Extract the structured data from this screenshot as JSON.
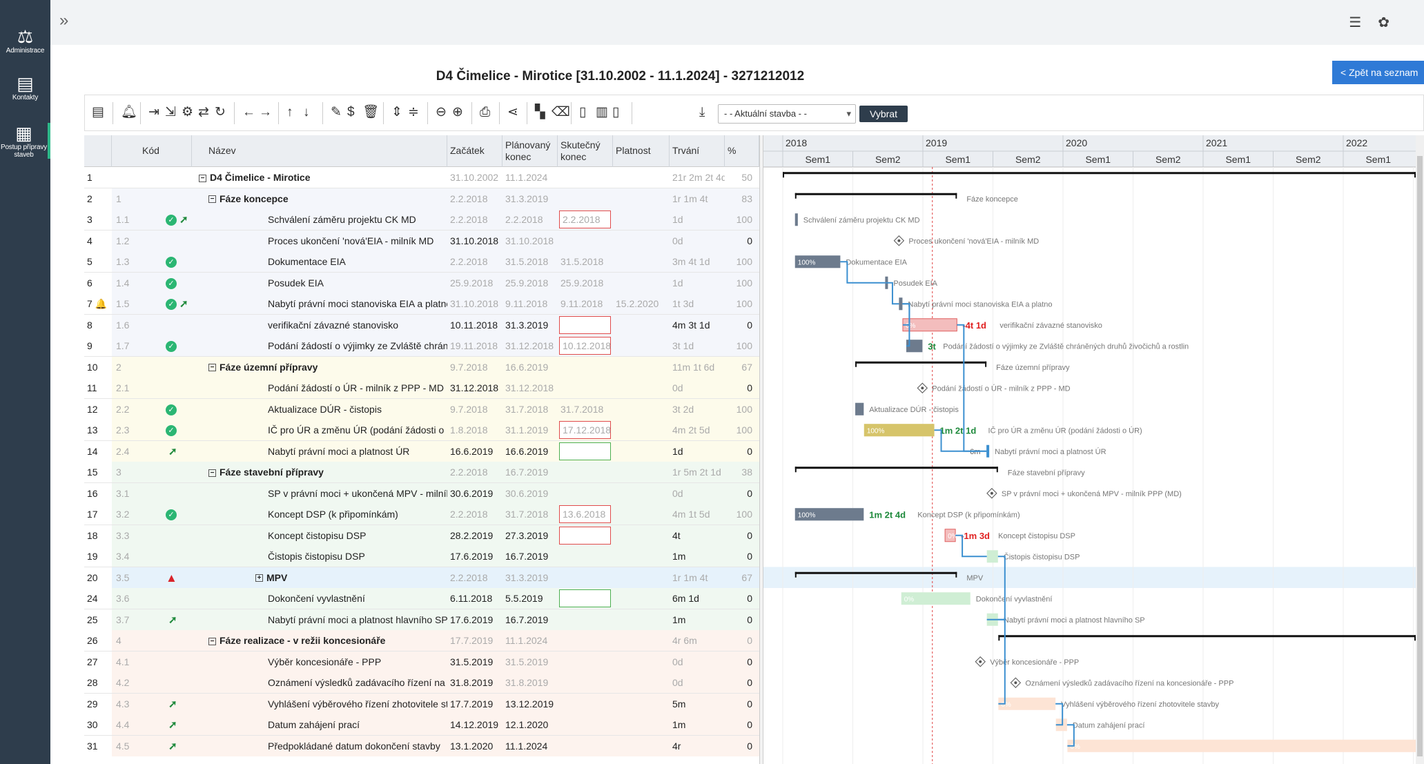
{
  "sidebar": [
    {
      "label": "Administrace",
      "icon": "scales-icon"
    },
    {
      "label": "Kontakty",
      "icon": "address-card-icon"
    },
    {
      "label": "Postup přípravy staveb",
      "icon": "building-icon"
    }
  ],
  "topbar": {
    "collapse_icon": "double-chevron-right-icon",
    "settings_icon": "sliders-icon",
    "user_icon": "paw-icon"
  },
  "page": {
    "title": "D4 Čimelice - Mirotice [31.10.2002 - 11.1.2024] - 3271212012",
    "back_label": "< Zpět na seznam"
  },
  "toolbar": {
    "select_value": "- - Aktuální stavba - -",
    "select_button": "Vybrat"
  },
  "columns": [
    "Kód",
    "Název",
    "Začátek",
    "Plánovaný konec",
    "Skutečný konec",
    "Platnost",
    "Trvání",
    "%"
  ],
  "rows": [
    {
      "n": "1",
      "code": "",
      "name": "D4 Čimelice - Mirotice",
      "start": "31.10.2002",
      "plan": "11.1.2024",
      "actual": "",
      "valid": "",
      "dur": "21r 2m 2t 4d",
      "pct": "50",
      "level": 0,
      "bold": true,
      "toggle": "−",
      "grey": true,
      "bg": "#ffffff"
    },
    {
      "n": "2",
      "code": "1",
      "name": "Fáze koncepce",
      "start": "2.2.2018",
      "plan": "31.3.2019",
      "actual": "",
      "valid": "",
      "dur": "1r 1m 4t",
      "pct": "83",
      "level": 1,
      "bold": true,
      "toggle": "−",
      "grey": true,
      "bg": "#f4f6fb"
    },
    {
      "n": "3",
      "code": "1.1",
      "name": "Schválení záměru projektu CK MD",
      "start": "2.2.2018",
      "plan": "2.2.2018",
      "actual": "2.2.2018",
      "valid": "",
      "dur": "1d",
      "pct": "100",
      "level": 2,
      "icons": [
        "check",
        "arrow"
      ],
      "box": "red",
      "grey": true,
      "bg": "#f4f6fb"
    },
    {
      "n": "4",
      "code": "1.2",
      "name": "Proces ukončení 'nová'EIA - milník MD",
      "start": "31.10.2018",
      "plan": "31.10.2018",
      "actual": "",
      "valid": "",
      "dur": "0d",
      "pct": "0",
      "level": 2,
      "grey": false,
      "planGrey": true,
      "durGrey": true,
      "bg": "#f4f6fb"
    },
    {
      "n": "5",
      "code": "1.3",
      "name": "Dokumentace EIA",
      "start": "2.2.2018",
      "plan": "31.5.2018",
      "actual": "31.5.2018",
      "valid": "",
      "dur": "3m 4t 1d",
      "pct": "100",
      "level": 2,
      "icons": [
        "check"
      ],
      "grey": true,
      "bg": "#f4f6fb"
    },
    {
      "n": "6",
      "code": "1.4",
      "name": "Posudek EIA",
      "start": "25.9.2018",
      "plan": "25.9.2018",
      "actual": "25.9.2018",
      "valid": "",
      "dur": "1d",
      "pct": "100",
      "level": 2,
      "icons": [
        "check"
      ],
      "grey": true,
      "bg": "#f4f6fb"
    },
    {
      "n": "7 🔔",
      "code": "1.5",
      "name": "Nabytí právní moci stanoviska EIA a platnost",
      "start": "31.10.2018",
      "plan": "9.11.2018",
      "actual": "9.11.2018",
      "valid": "15.2.2020",
      "dur": "1t 3d",
      "pct": "100",
      "level": 2,
      "icons": [
        "check",
        "arrow"
      ],
      "grey": true,
      "bg": "#f4f6fb"
    },
    {
      "n": "8",
      "code": "1.6",
      "name": "verifikační závazné stanovisko",
      "start": "10.11.2018",
      "plan": "31.3.2019",
      "actual": "",
      "valid": "",
      "dur": "4m 3t 1d",
      "pct": "0",
      "level": 2,
      "box": "red",
      "grey": false,
      "bg": "#f4f6fb"
    },
    {
      "n": "9",
      "code": "1.7",
      "name": "Podání žádostí o výjimky ze Zvláště chráněných d",
      "start": "19.11.2018",
      "plan": "31.12.2018",
      "actual": "10.12.2018",
      "valid": "",
      "dur": "3t 1d",
      "pct": "100",
      "level": 2,
      "icons": [
        "check"
      ],
      "box": "red",
      "grey": true,
      "bg": "#f4f6fb"
    },
    {
      "n": "10",
      "code": "2",
      "name": "Fáze územní přípravy",
      "start": "9.7.2018",
      "plan": "16.6.2019",
      "actual": "",
      "valid": "",
      "dur": "11m 1t 6d",
      "pct": "67",
      "level": 1,
      "bold": true,
      "toggle": "−",
      "grey": true,
      "bg": "#fdfbeb"
    },
    {
      "n": "11",
      "code": "2.1",
      "name": "Podání žádostí o ÚR - milník z PPP - MD",
      "start": "31.12.2018",
      "plan": "31.12.2018",
      "actual": "",
      "valid": "",
      "dur": "0d",
      "pct": "0",
      "level": 2,
      "grey": false,
      "planGrey": true,
      "durGrey": true,
      "bg": "#fdfbeb"
    },
    {
      "n": "12",
      "code": "2.2",
      "name": "Aktualizace DÚR - čistopis",
      "start": "9.7.2018",
      "plan": "31.7.2018",
      "actual": "31.7.2018",
      "valid": "",
      "dur": "3t 2d",
      "pct": "100",
      "level": 2,
      "icons": [
        "check"
      ],
      "grey": true,
      "bg": "#fdfbeb"
    },
    {
      "n": "13",
      "code": "2.3",
      "name": "IČ pro ÚR a změnu ÚR (podání žádosti o ÚR)",
      "start": "1.8.2018",
      "plan": "31.1.2019",
      "actual": "17.12.2018",
      "valid": "",
      "dur": "4m 2t 5d",
      "pct": "100",
      "level": 2,
      "icons": [
        "check"
      ],
      "box": "red",
      "grey": true,
      "bg": "#fdfbeb"
    },
    {
      "n": "14",
      "code": "2.4",
      "name": "Nabytí právní moci a platnost ÚR",
      "start": "16.6.2019",
      "plan": "16.6.2019",
      "actual": "",
      "valid": "",
      "dur": "1d",
      "pct": "0",
      "level": 2,
      "icons": [
        "arrow"
      ],
      "box": "green",
      "grey": false,
      "bg": "#fdfbeb"
    },
    {
      "n": "15",
      "code": "3",
      "name": "Fáze stavební přípravy",
      "start": "2.2.2018",
      "plan": "16.7.2019",
      "actual": "",
      "valid": "",
      "dur": "1r 5m 2t 1d",
      "pct": "38",
      "level": 1,
      "bold": true,
      "toggle": "−",
      "grey": true,
      "bg": "#f0f8f1"
    },
    {
      "n": "16",
      "code": "3.1",
      "name": "SP v právní moci + ukončená MPV - milník PPP (",
      "start": "30.6.2019",
      "plan": "30.6.2019",
      "actual": "",
      "valid": "",
      "dur": "0d",
      "pct": "0",
      "level": 2,
      "grey": false,
      "planGrey": true,
      "durGrey": true,
      "bg": "#f0f8f1"
    },
    {
      "n": "17",
      "code": "3.2",
      "name": "Koncept DSP (k připomínkám)",
      "start": "2.2.2018",
      "plan": "31.7.2018",
      "actual": "13.6.2018",
      "valid": "",
      "dur": "4m 1t 5d",
      "pct": "100",
      "level": 2,
      "icons": [
        "check"
      ],
      "box": "red",
      "grey": true,
      "bg": "#f0f8f1"
    },
    {
      "n": "18",
      "code": "3.3",
      "name": "Koncept čistopisu DSP",
      "start": "28.2.2019",
      "plan": "27.3.2019",
      "actual": "",
      "valid": "",
      "dur": "4t",
      "pct": "0",
      "level": 2,
      "box": "red",
      "grey": false,
      "bg": "#f0f8f1"
    },
    {
      "n": "19",
      "code": "3.4",
      "name": "Čistopis čistopisu DSP",
      "start": "17.6.2019",
      "plan": "16.7.2019",
      "actual": "",
      "valid": "",
      "dur": "1m",
      "pct": "0",
      "level": 2,
      "grey": false,
      "bg": "#f0f8f1"
    },
    {
      "n": "20",
      "code": "3.5",
      "name": "MPV",
      "start": "2.2.2018",
      "plan": "31.3.2019",
      "actual": "",
      "valid": "",
      "dur": "1r 1m 4t",
      "pct": "67",
      "level": 1.5,
      "bold": true,
      "toggle": "+",
      "icons": [
        "warn"
      ],
      "grey": true,
      "bg": "#e6f2fb"
    },
    {
      "n": "24",
      "code": "3.6",
      "name": "Dokončení vyvlastnění",
      "start": "6.11.2018",
      "plan": "5.5.2019",
      "actual": "",
      "valid": "",
      "dur": "6m 1d",
      "pct": "0",
      "level": 2,
      "box": "green",
      "grey": false,
      "bg": "#f0f8f1"
    },
    {
      "n": "25",
      "code": "3.7",
      "name": "Nabytí právní moci a platnost hlavního SP",
      "start": "17.6.2019",
      "plan": "16.7.2019",
      "actual": "",
      "valid": "",
      "dur": "1m",
      "pct": "0",
      "level": 2,
      "icons": [
        "arrow"
      ],
      "grey": false,
      "bg": "#f0f8f1"
    },
    {
      "n": "26",
      "code": "4",
      "name": "Fáze realizace - v režii koncesionáře",
      "start": "17.7.2019",
      "plan": "11.1.2024",
      "actual": "",
      "valid": "",
      "dur": "4r 6m",
      "pct": "0",
      "level": 1,
      "bold": true,
      "toggle": "−",
      "grey": true,
      "bg": "#fdf3ee"
    },
    {
      "n": "27",
      "code": "4.1",
      "name": "Výběr koncesionáře - PPP",
      "start": "31.5.2019",
      "plan": "31.5.2019",
      "actual": "",
      "valid": "",
      "dur": "0d",
      "pct": "0",
      "level": 2,
      "grey": false,
      "planGrey": true,
      "durGrey": true,
      "bg": "#fdf3ee"
    },
    {
      "n": "28",
      "code": "4.2",
      "name": "Oznámení výsledků zadávacího řízení na koncesi",
      "start": "31.8.2019",
      "plan": "31.8.2019",
      "actual": "",
      "valid": "",
      "dur": "0d",
      "pct": "0",
      "level": 2,
      "grey": false,
      "planGrey": true,
      "durGrey": true,
      "bg": "#fdf3ee"
    },
    {
      "n": "29",
      "code": "4.3",
      "name": "Vyhlášení výběrového řízení zhotovitele stavby",
      "start": "17.7.2019",
      "plan": "13.12.2019",
      "actual": "",
      "valid": "",
      "dur": "5m",
      "pct": "0",
      "level": 2,
      "icons": [
        "arrow"
      ],
      "grey": false,
      "bg": "#fdf3ee"
    },
    {
      "n": "30",
      "code": "4.4",
      "name": "Datum zahájení prací",
      "start": "14.12.2019",
      "plan": "12.1.2020",
      "actual": "",
      "valid": "",
      "dur": "1m",
      "pct": "0",
      "level": 2,
      "icons": [
        "arrow"
      ],
      "grey": false,
      "bg": "#fdf3ee"
    },
    {
      "n": "31",
      "code": "4.5",
      "name": "Předpokládané datum dokončení stavby",
      "start": "13.1.2020",
      "plan": "11.1.2024",
      "actual": "",
      "valid": "",
      "dur": "4r",
      "pct": "0",
      "level": 2,
      "icons": [
        "arrow"
      ],
      "grey": false,
      "bg": "#fdf3ee"
    }
  ],
  "gantt": {
    "years": [
      "2018",
      "2019",
      "2020",
      "2021",
      "2022"
    ],
    "semesters": [
      "Sem1",
      "Sem2",
      "Sem1",
      "Sem2",
      "Sem1",
      "Sem2",
      "Sem1",
      "Sem2",
      "Sem1"
    ],
    "colors": {
      "done": "#6d7b8d",
      "doneLight": "#c7ced9",
      "late": "#e06060",
      "lateLight": "#f3bdbd",
      "yellow": "#d6c46a",
      "green": "#8fcf98",
      "orange": "#f8c6aa",
      "link": "#3b8fd0",
      "today": "#e04040"
    },
    "items": [
      {
        "row": 1,
        "kind": "summary",
        "start": "2018-01-01",
        "end": "2022-12-31",
        "label": ""
      },
      {
        "row": 2,
        "kind": "summary",
        "start": "2018-02-02",
        "end": "2019-03-31",
        "label": "Fáze koncepce"
      },
      {
        "row": 3,
        "kind": "bar",
        "start": "2018-02-02",
        "end": "2018-02-03",
        "color": "done",
        "label": "Schválení záměru projektu CK MD"
      },
      {
        "row": 4,
        "kind": "milestone",
        "start": "2018-10-31",
        "label": "Proces ukončení 'nová'EIA - milník MD"
      },
      {
        "row": 5,
        "kind": "bar",
        "start": "2018-02-02",
        "end": "2018-05-31",
        "color": "done",
        "pct": "100%",
        "label": "Dokumentace EIA"
      },
      {
        "row": 6,
        "kind": "bar",
        "start": "2018-09-25",
        "end": "2018-09-26",
        "color": "done",
        "label": "Posudek EIA"
      },
      {
        "row": 7,
        "kind": "bar",
        "start": "2018-10-31",
        "end": "2018-11-09",
        "color": "done",
        "label": "Nabytí právní moci stanoviska EIA a platno"
      },
      {
        "row": 8,
        "kind": "bar",
        "start": "2018-11-10",
        "end": "2019-03-31",
        "color": "late",
        "pct": "0%",
        "delta": "-4t 1d",
        "deltaColor": "#e02020",
        "label": "verifikační závazné stanovisko"
      },
      {
        "row": 9,
        "kind": "bar",
        "start": "2018-11-19",
        "end": "2018-12-31",
        "color": "done",
        "delta": "3t",
        "deltaColor": "#1f8a3c",
        "label": "Podání žádostí o výjimky ze Zvláště chráněných druhů živočichů a rostlin"
      },
      {
        "row": 10,
        "kind": "summary",
        "start": "2018-07-09",
        "end": "2019-06-16",
        "label": "Fáze územní přípravy"
      },
      {
        "row": 11,
        "kind": "milestone",
        "start": "2018-12-31",
        "label": "Podání žádostí o ÚR - milník z PPP - MD"
      },
      {
        "row": 12,
        "kind": "bar",
        "start": "2018-07-09",
        "end": "2018-07-31",
        "color": "done",
        "label": "Aktualizace DÚR - čistopis"
      },
      {
        "row": 13,
        "kind": "bar",
        "start": "2018-08-01",
        "end": "2019-01-31",
        "color": "yellow",
        "pct": "100%",
        "delta": "1m 2t 1d",
        "deltaColor": "#1f8a3c",
        "label": "IČ pro ÚR a změnu ÚR (podání žádosti o ÚR)"
      },
      {
        "row": 14,
        "kind": "bar",
        "start": "2019-06-16",
        "end": "2019-06-17",
        "color": "link",
        "pre": "6m",
        "label": "Nabytí právní moci a platnost ÚR"
      },
      {
        "row": 15,
        "kind": "summary",
        "start": "2018-02-02",
        "end": "2019-07-16",
        "label": "Fáze stavební přípravy"
      },
      {
        "row": 16,
        "kind": "milestone",
        "start": "2019-06-30",
        "label": "SP v právní moci + ukončená MPV - milník PPP (MD)"
      },
      {
        "row": 17,
        "kind": "bar",
        "start": "2018-02-02",
        "end": "2018-07-31",
        "color": "done",
        "pct": "100%",
        "delta": "1m 2t 4d",
        "deltaColor": "#1f8a3c",
        "label": "Koncept DSP (k připomínkám)"
      },
      {
        "row": 18,
        "kind": "bar",
        "start": "2019-02-28",
        "end": "2019-03-27",
        "color": "late",
        "pct": "0%",
        "delta": "-1m 3d",
        "deltaColor": "#e02020",
        "label": "Koncept čistopisu DSP"
      },
      {
        "row": 19,
        "kind": "bar",
        "start": "2019-06-17",
        "end": "2019-07-16",
        "color": "green",
        "label": "Čistopis čistopisu DSP"
      },
      {
        "row": 20,
        "kind": "summary",
        "start": "2018-02-02",
        "end": "2019-03-31",
        "label": "MPV"
      },
      {
        "row": 21,
        "kind": "bar",
        "start": "2018-11-06",
        "end": "2019-05-05",
        "color": "green",
        "pct": "0%",
        "label": "Dokončení vyvlastnění"
      },
      {
        "row": 22,
        "kind": "bar",
        "start": "2019-06-17",
        "end": "2019-07-16",
        "color": "green",
        "label": "Nabytí právní moci a platnost hlavního SP"
      },
      {
        "row": 23,
        "kind": "summary",
        "start": "2019-07-17",
        "end": "2022-12-31",
        "label": ""
      },
      {
        "row": 24,
        "kind": "milestone",
        "start": "2019-05-31",
        "label": "Výběr koncesionáře - PPP"
      },
      {
        "row": 25,
        "kind": "milestone",
        "start": "2019-08-31",
        "label": "Oznámení výsledků zadávacího řízení na koncesionáře - PPP"
      },
      {
        "row": 26,
        "kind": "bar",
        "start": "2019-07-17",
        "end": "2019-12-13",
        "color": "orange",
        "pct": "0%",
        "label": "Vyhlášení výběrového řízení zhotovitele stavby"
      },
      {
        "row": 27,
        "kind": "bar",
        "start": "2019-12-14",
        "end": "2020-01-12",
        "color": "orange",
        "label": "Datum zahájení prací"
      },
      {
        "row": 28,
        "kind": "bar",
        "start": "2020-01-13",
        "end": "2022-12-31",
        "color": "orange",
        "pct": "0%",
        "label": ""
      }
    ],
    "today": "2019-01-26"
  }
}
